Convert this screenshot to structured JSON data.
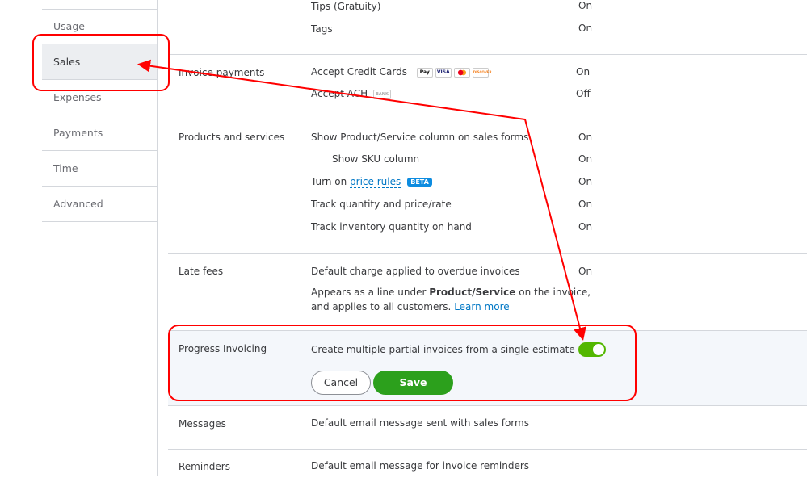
{
  "sidebar": {
    "items": [
      {
        "label": "Usage"
      },
      {
        "label": "Sales",
        "active": true
      },
      {
        "label": "Expenses"
      },
      {
        "label": "Payments"
      },
      {
        "label": "Time"
      },
      {
        "label": "Advanced"
      }
    ]
  },
  "sections": {
    "top": {
      "rows": [
        {
          "label": "Tips (Gratuity)",
          "value": "On"
        },
        {
          "label": "Tags",
          "value": "On"
        }
      ]
    },
    "invoice_payments": {
      "title": "Invoice payments",
      "rows": [
        {
          "label": "Accept Credit Cards",
          "value": "On",
          "icons": [
            "Pay",
            "VISA",
            "mastercard",
            "DISCOVER"
          ]
        },
        {
          "label": "Accept ACH",
          "value": "Off",
          "icon": "BANK"
        }
      ]
    },
    "products": {
      "title": "Products and services",
      "rows": [
        {
          "label": "Show Product/Service column on sales forms",
          "value": "On"
        },
        {
          "label": "Show SKU column",
          "value": "On"
        },
        {
          "prefix": "Turn on",
          "link": "price rules",
          "badge": "BETA",
          "value": "On"
        },
        {
          "label": "Track quantity and price/rate",
          "value": "On"
        },
        {
          "label": "Track inventory quantity on hand",
          "value": "On"
        }
      ]
    },
    "late_fees": {
      "title": "Late fees",
      "rows": [
        {
          "label": "Default charge applied to overdue invoices",
          "value": "On"
        }
      ],
      "note_pre": "Appears as a line under",
      "note_bold": "Product/Service",
      "note_post": "on the invoice,",
      "note_line2": "and applies to all customers.",
      "learn_more": "Learn more"
    },
    "progress": {
      "title": "Progress Invoicing",
      "label": "Create multiple partial invoices from a single estimate",
      "toggle_on": true,
      "cancel": "Cancel",
      "save": "Save"
    },
    "messages": {
      "title": "Messages",
      "label": "Default email message sent with sales forms"
    },
    "reminders": {
      "title": "Reminders",
      "label": "Default email message for invoice reminders"
    }
  },
  "colors": {
    "accent": "#2ca01c",
    "toggle": "#53b700",
    "link": "#0077c5",
    "annotation": "#ff0000",
    "highlight_bg": "#f4f7fb"
  }
}
